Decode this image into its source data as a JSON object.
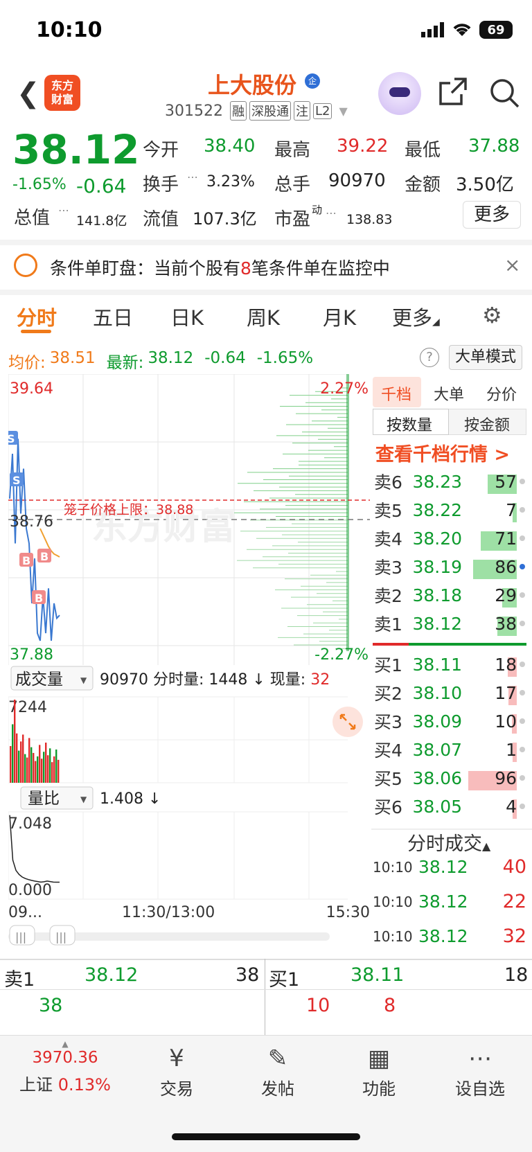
{
  "status": {
    "time": "10:10",
    "battery": "69"
  },
  "header": {
    "logo_line1": "东方",
    "logo_line2": "财富",
    "stock_name": "上大股份",
    "name_badge": "企",
    "stock_code": "301522",
    "tags": [
      "融",
      "深股通",
      "注",
      "L2"
    ]
  },
  "quote": {
    "price": "38.12",
    "change_pct": "-1.65%",
    "change": "-0.64",
    "open_label": "今开",
    "open": "38.40",
    "high_label": "最高",
    "high": "39.22",
    "low_label": "最低",
    "low": "37.88",
    "turnover_label": "换手",
    "turnover": "3.23%",
    "volume_label": "总手",
    "volume": "90970",
    "amount_label": "金额",
    "amount": "3.50亿",
    "mktcap_label": "总值",
    "mktcap": "141.8亿",
    "float_label": "流值",
    "float": "107.3亿",
    "pe_label": "市盈",
    "pe_sup": "动",
    "pe": "138.83",
    "more_button": "更多"
  },
  "alert": {
    "prefix": "条件单盯盘：当前个股有",
    "count": "8",
    "suffix": "笔条件单在监控中",
    "close": "×"
  },
  "tabs": [
    "分时",
    "五日",
    "日K",
    "周K",
    "月K",
    "更多"
  ],
  "info_line": {
    "avg_label": "均价:",
    "avg": "38.51",
    "latest_label": "最新:",
    "latest": "38.12",
    "latest_chg": "-0.64",
    "latest_pct": "-1.65%",
    "help": "?",
    "big_order_button": "大单模式"
  },
  "intraday_chart": {
    "top_price": "39.64",
    "top_pct": "2.27%",
    "ref_price": "38.76",
    "bottom_price": "37.88",
    "bottom_pct": "-2.27%",
    "limit_label": "笼子价格上限：38.88",
    "watermark": "东方财富",
    "x_labels": [
      "09...",
      "11:30/13:00",
      "15:30"
    ],
    "marker_s": "S",
    "marker_b": "B"
  },
  "chart_data": {
    "type": "line",
    "title": "",
    "ylim": [
      37.88,
      39.64
    ],
    "ref_price": 38.76,
    "limit_price": 38.88,
    "series": [
      {
        "name": "",
        "color": "#3a78d0",
        "values": [
          38.9,
          39.2,
          38.6,
          39.3,
          38.8,
          39.1,
          38.7,
          38.6,
          38.2,
          38.5,
          38.0,
          37.95,
          38.25,
          38.0,
          38.3,
          37.95,
          38.2,
          38.1,
          38.12
        ]
      },
      {
        "name": "",
        "color": "#f0a030",
        "values": [
          null,
          null,
          null,
          null,
          null,
          null,
          null,
          null,
          null,
          null,
          null,
          38.7,
          38.66,
          38.62,
          38.58,
          38.55,
          38.53,
          38.52,
          38.51
        ]
      }
    ],
    "volume_max": "7244",
    "volume_bars": [
      3200,
      5100,
      7244,
      4300,
      2800,
      3600,
      4200,
      2500,
      2200,
      3900,
      3100,
      2600,
      1900,
      2300,
      3300,
      2100,
      2700,
      3500,
      2400,
      3000,
      1800,
      2300,
      2900,
      2000
    ],
    "ratio_max": "7.048",
    "ratio_min": "0.000",
    "ratio_values": [
      7.0,
      2.6,
      1.6,
      1.2,
      0.95,
      0.8,
      0.7,
      0.62,
      0.55,
      0.5,
      0.45,
      0.48,
      0.55,
      0.5,
      0.45,
      0.44,
      0.44
    ]
  },
  "volume_panel": {
    "selector": "成交量",
    "total": "90970",
    "tick_label": "分时量:",
    "tick": "1448",
    "now_label": "现量:",
    "now": "32"
  },
  "ratio_panel": {
    "selector": "量比",
    "value": "1.408"
  },
  "order_book": {
    "tabs": [
      "千档",
      "大单",
      "分价"
    ],
    "modes": [
      "按数量",
      "按金额"
    ],
    "link": "查看千档行情 >",
    "asks": [
      {
        "label": "卖6",
        "price": "38.23",
        "vol": "57",
        "bar": 0.6
      },
      {
        "label": "卖5",
        "price": "38.22",
        "vol": "7",
        "bar": 0.08
      },
      {
        "label": "卖4",
        "price": "38.20",
        "vol": "71",
        "bar": 0.75
      },
      {
        "label": "卖3",
        "price": "38.19",
        "vol": "86",
        "bar": 0.9
      },
      {
        "label": "卖2",
        "price": "38.18",
        "vol": "29",
        "bar": 0.3
      },
      {
        "label": "卖1",
        "price": "38.12",
        "vol": "38",
        "bar": 0.4
      }
    ],
    "bids": [
      {
        "label": "买1",
        "price": "38.11",
        "vol": "18",
        "bar": 0.18
      },
      {
        "label": "买2",
        "price": "38.10",
        "vol": "17",
        "bar": 0.17
      },
      {
        "label": "买3",
        "price": "38.09",
        "vol": "10",
        "bar": 0.1
      },
      {
        "label": "买4",
        "price": "38.07",
        "vol": "1",
        "bar": 0.01
      },
      {
        "label": "买5",
        "price": "38.06",
        "vol": "96",
        "bar": 1.0
      },
      {
        "label": "买6",
        "price": "38.05",
        "vol": "4",
        "bar": 0.04
      }
    ]
  },
  "time_trades": {
    "title": "分时成交",
    "rows": [
      {
        "time": "10:10",
        "price": "38.12",
        "vol": "40"
      },
      {
        "time": "10:10",
        "price": "38.12",
        "vol": "22"
      },
      {
        "time": "10:10",
        "price": "38.12",
        "vol": "32"
      }
    ]
  },
  "level1": {
    "ask_label": "卖1",
    "ask_price": "38.12",
    "ask_vol": "38",
    "ask_queue": "38",
    "bid_label": "买1",
    "bid_price": "38.11",
    "bid_vol": "18",
    "bid_queue": [
      "10",
      "8"
    ]
  },
  "nav": {
    "index_value": "3970.36",
    "index_name": "上证",
    "index_pct": "0.13%",
    "items": [
      "交易",
      "发帖",
      "功能",
      "设自选"
    ]
  }
}
